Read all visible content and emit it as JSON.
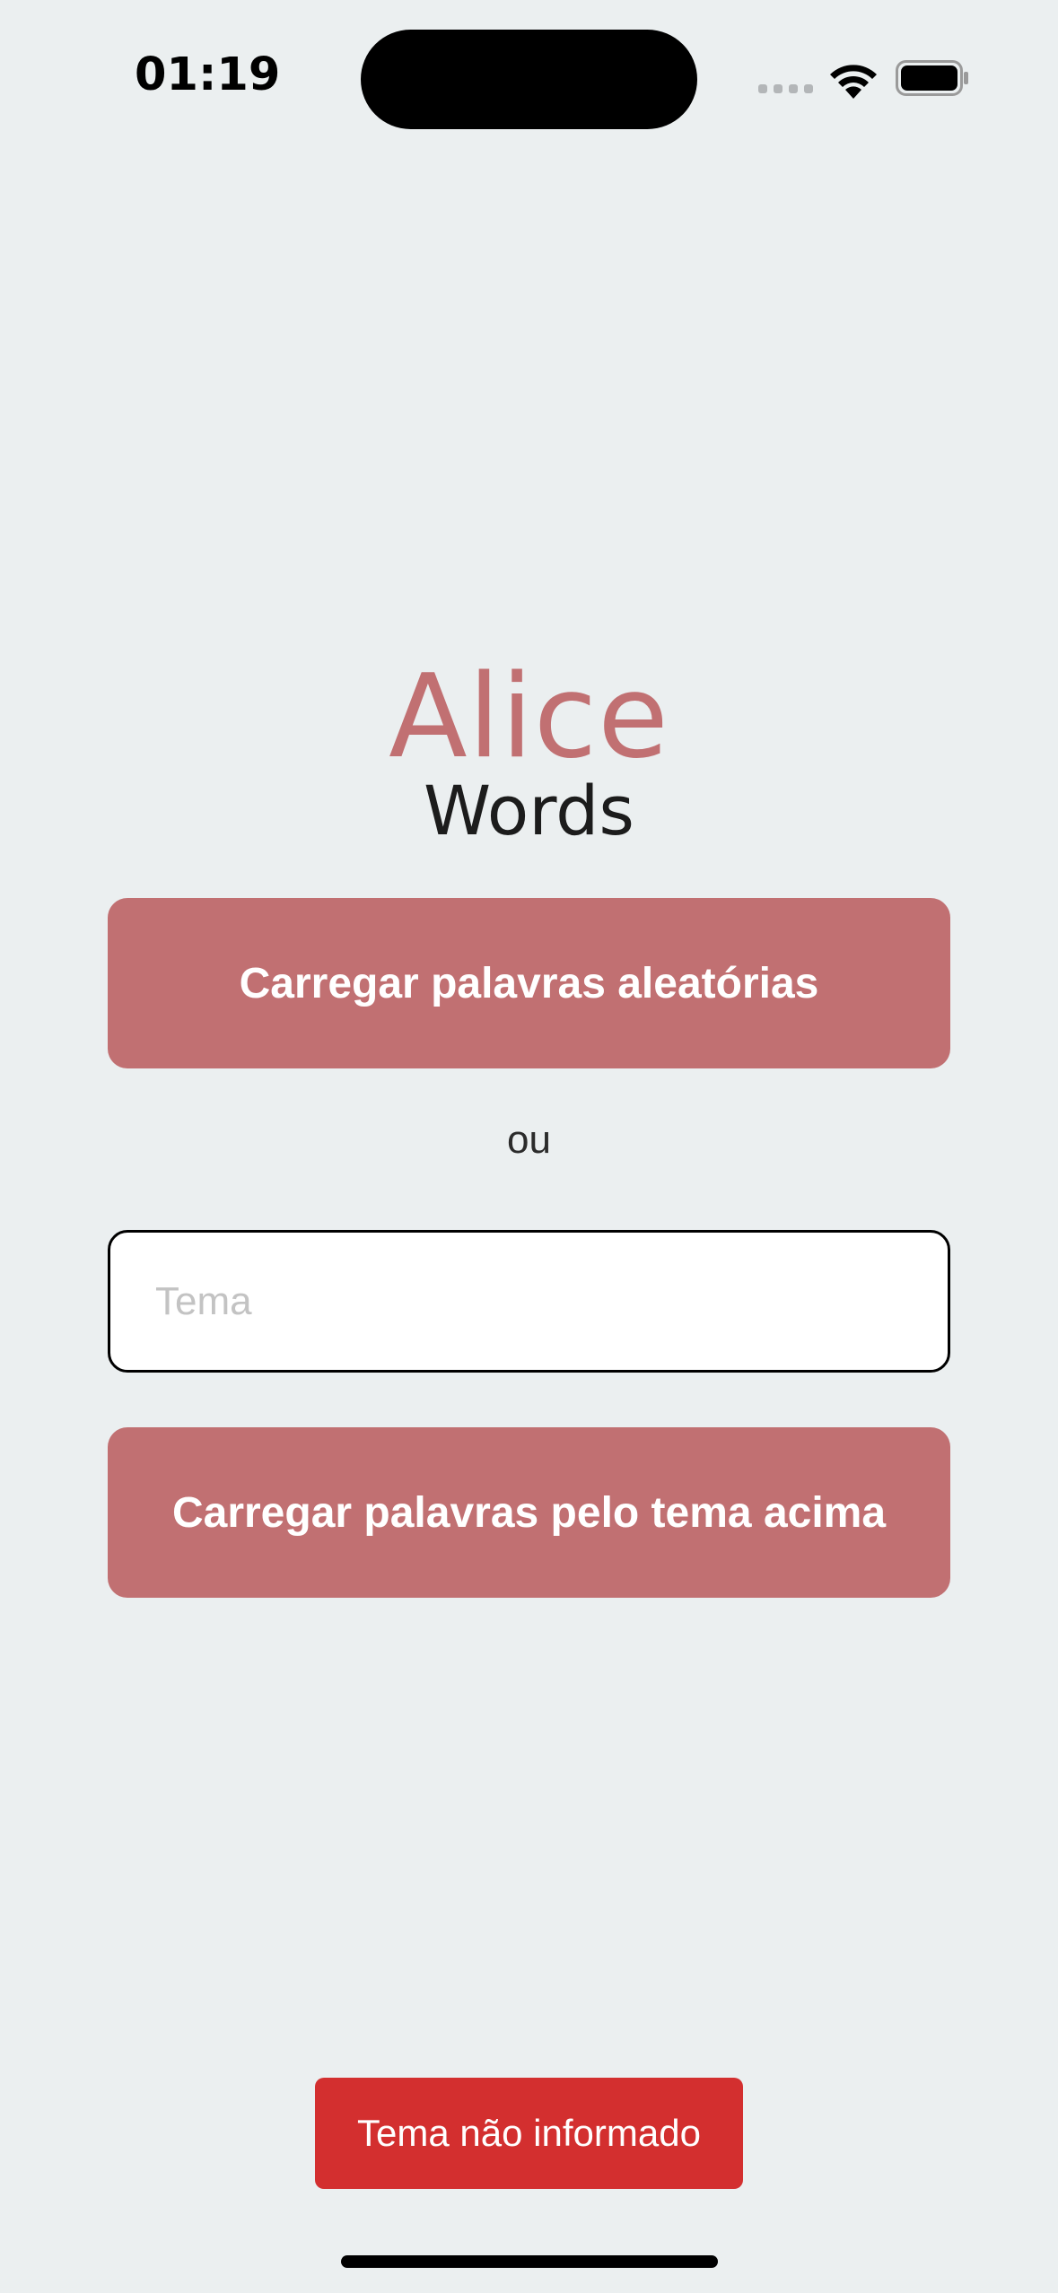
{
  "status_bar": {
    "time": "01:19",
    "icons": [
      "signal-icon",
      "wifi-icon",
      "battery-icon"
    ]
  },
  "logo": {
    "title": "Alice",
    "subtitle": "Words",
    "accent_color": "#c17072"
  },
  "actions": {
    "random_button_label": "Carregar palavras aleatórias",
    "or_text": "ou",
    "theme_input": {
      "value": "",
      "placeholder": "Tema"
    },
    "theme_button_label": "Carregar palavras pelo tema acima"
  },
  "toast": {
    "message": "Tema não informado",
    "color": "#d32f2f"
  },
  "colors": {
    "background": "#ebeff0",
    "button": "#c17072",
    "error": "#d32f2f"
  }
}
